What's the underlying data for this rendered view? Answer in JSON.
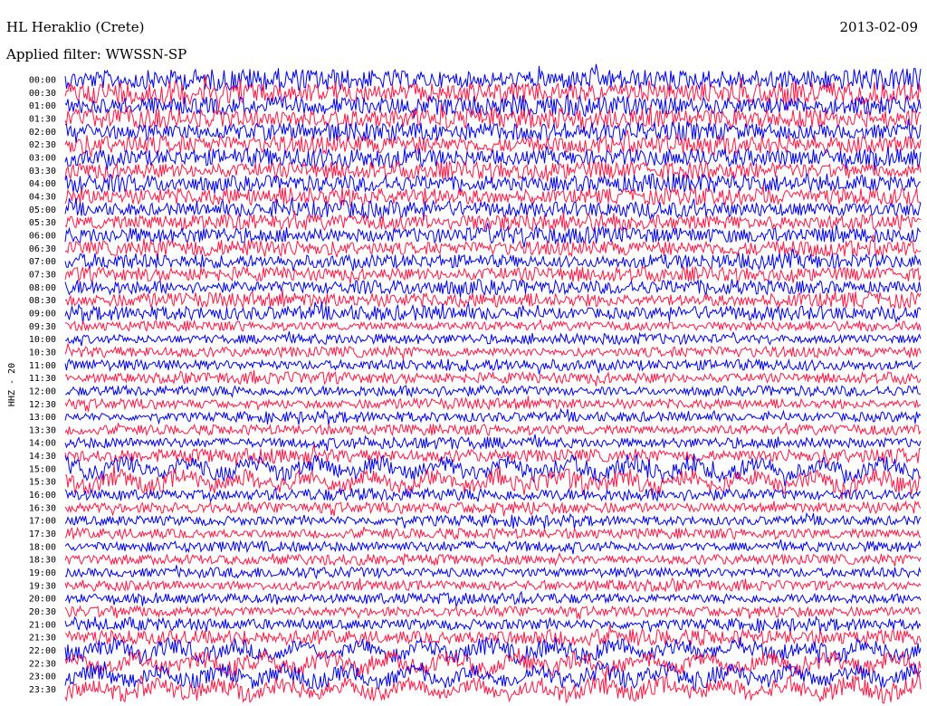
{
  "header": {
    "station": "HL Heraklio (Crete)",
    "date": "2013-02-09",
    "filter_text": "Applied filter: WWSSN-SP"
  },
  "channel_label": "HHZ - 20",
  "colors": {
    "trace_a": "#0000ee",
    "trace_b": "#ff1744",
    "text": "#000000",
    "background": "#ffffff"
  },
  "chart_data": {
    "type": "line",
    "title": "HL Heraklio (Crete)",
    "subtitle": "Applied filter: WWSSN-SP",
    "ylabel": "HHZ - 20",
    "xlabel": "",
    "grid": false,
    "legend": "none",
    "y_categories": [
      "00:00",
      "00:30",
      "01:00",
      "01:30",
      "02:00",
      "02:30",
      "03:00",
      "03:30",
      "04:00",
      "04:30",
      "05:00",
      "05:30",
      "06:00",
      "06:30",
      "07:00",
      "07:30",
      "08:00",
      "08:30",
      "09:00",
      "09:30",
      "10:00",
      "10:30",
      "11:00",
      "11:30",
      "12:00",
      "12:30",
      "13:00",
      "13:30",
      "14:00",
      "14:30",
      "15:00",
      "15:30",
      "16:00",
      "16:30",
      "17:00",
      "17:30",
      "18:00",
      "18:30",
      "19:00",
      "19:30",
      "20:00",
      "20:30",
      "21:00",
      "21:30",
      "22:00",
      "22:30",
      "23:00",
      "23:30"
    ],
    "trace_color_order": [
      "blue",
      "red"
    ],
    "relative_amplitude": [
      1.0,
      1.0,
      0.95,
      0.95,
      0.9,
      0.9,
      0.9,
      0.85,
      0.85,
      0.85,
      0.8,
      0.8,
      0.8,
      0.75,
      0.7,
      0.7,
      0.7,
      0.7,
      0.7,
      0.45,
      0.5,
      0.5,
      0.55,
      0.55,
      0.5,
      0.5,
      0.5,
      0.5,
      0.55,
      0.65,
      0.9,
      0.85,
      0.6,
      0.55,
      0.5,
      0.5,
      0.5,
      0.5,
      0.5,
      0.5,
      0.5,
      0.5,
      0.55,
      0.75,
      0.85,
      0.85,
      0.85,
      0.85
    ]
  }
}
